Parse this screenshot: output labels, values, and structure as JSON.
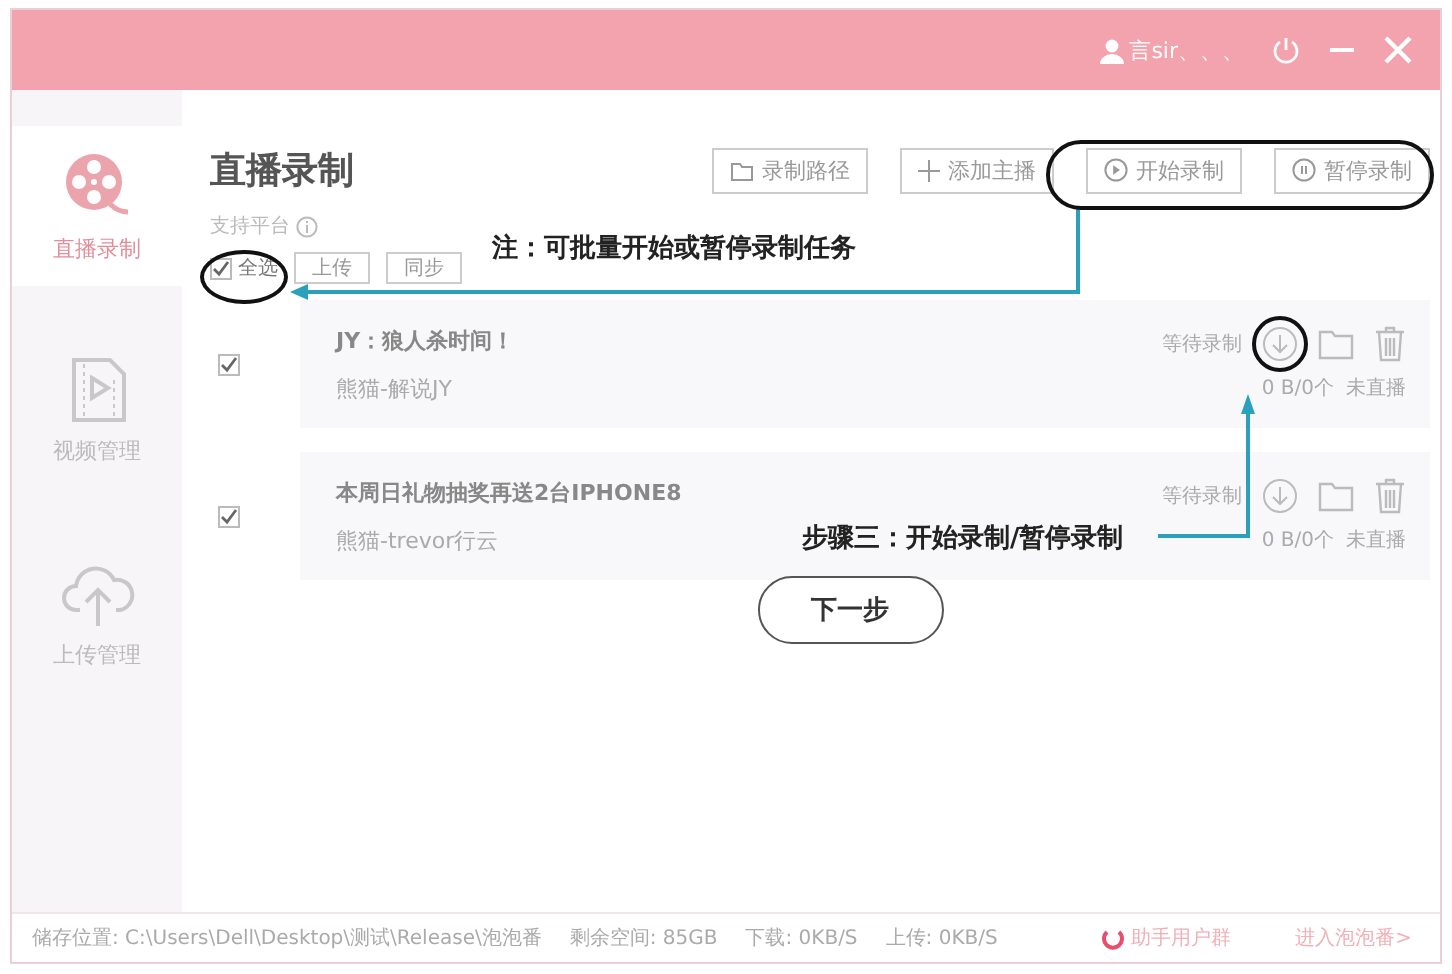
{
  "title_bar": {
    "user": "言sir、、、"
  },
  "sidebar": {
    "items": [
      {
        "kind": "record",
        "label": "直播录制",
        "selected": true
      },
      {
        "kind": "video",
        "label": "视频管理",
        "selected": false
      },
      {
        "kind": "upload",
        "label": "上传管理",
        "selected": false
      }
    ]
  },
  "header": {
    "title": "直播录制",
    "platform_label": "支持平台",
    "buttons": [
      {
        "kind": "folder",
        "label": "录制路径"
      },
      {
        "kind": "add",
        "label": "添加主播"
      },
      {
        "kind": "play",
        "label": "开始录制"
      },
      {
        "kind": "pause",
        "label": "暂停录制"
      }
    ]
  },
  "toolbar": {
    "select_all": {
      "label": "全选",
      "checked": true
    },
    "buttons": [
      "上传",
      "同步"
    ]
  },
  "tasks": [
    {
      "title": "JY：狼人杀时间！",
      "source": "熊猫-解说JY",
      "status": "等待录制",
      "size": "0 B/0个",
      "live": "未直播",
      "checked": true
    },
    {
      "title": "本周日礼物抽奖再送2台IPHONE8",
      "source": "熊猫-trevor行云",
      "status": "等待录制",
      "size": "0 B/0个",
      "live": "未直播",
      "checked": true
    }
  ],
  "next_button": "下一步",
  "annotations": [
    {
      "text": "注：可批量开始或暂停录制任务"
    },
    {
      "text": "步骤三：开始录制/暂停录制"
    }
  ],
  "status_bar": {
    "storage": "储存位置: C:\\Users\\Dell\\Desktop\\测试\\Release\\泡泡番",
    "free": "剩余空间: 85GB",
    "download": "下载: 0KB/S",
    "upload": "上传: 0KB/S",
    "help": "助手用户群",
    "enter": "进入泡泡番>"
  }
}
